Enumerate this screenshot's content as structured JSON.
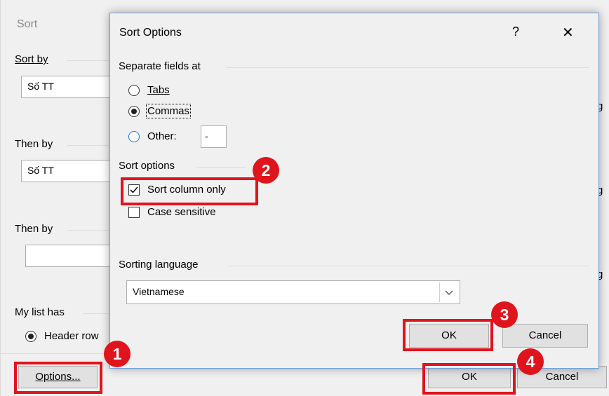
{
  "background": {
    "title": "Sort",
    "sort_by_label": "Sort by",
    "sort_by_value": "Số TT",
    "then_by_label_1": "Then by",
    "then_by_value_1": "Số TT",
    "then_by_label_2": "Then by",
    "then_by_value_2": "",
    "my_list_has_label": "My list has",
    "header_row_label": "Header row",
    "options_button": "Options...",
    "ok_button": "OK",
    "cancel_button": "Cancel",
    "edge_char_1": "g",
    "edge_char_2": "g",
    "edge_char_3": "g"
  },
  "dialog": {
    "title": "Sort Options",
    "help_label": "?",
    "close_label": "✕",
    "separate_fields_label": "Separate fields at",
    "tabs_label": "Tabs",
    "commas_label": "Commas",
    "other_label": "Other:",
    "other_value": "-",
    "sort_options_label": "Sort options",
    "sort_column_only_label": "Sort column only",
    "case_sensitive_label": "Case sensitive",
    "sorting_language_label": "Sorting language",
    "sorting_language_value": "Vietnamese",
    "ok_button": "OK",
    "cancel_button": "Cancel"
  },
  "annotations": {
    "step_1": "1",
    "step_2": "2",
    "step_3": "3",
    "step_4": "4"
  },
  "colors": {
    "highlight_red": "#e0141c",
    "dialog_border": "#6aa0e0",
    "radio_blue": "#1e73d9"
  }
}
